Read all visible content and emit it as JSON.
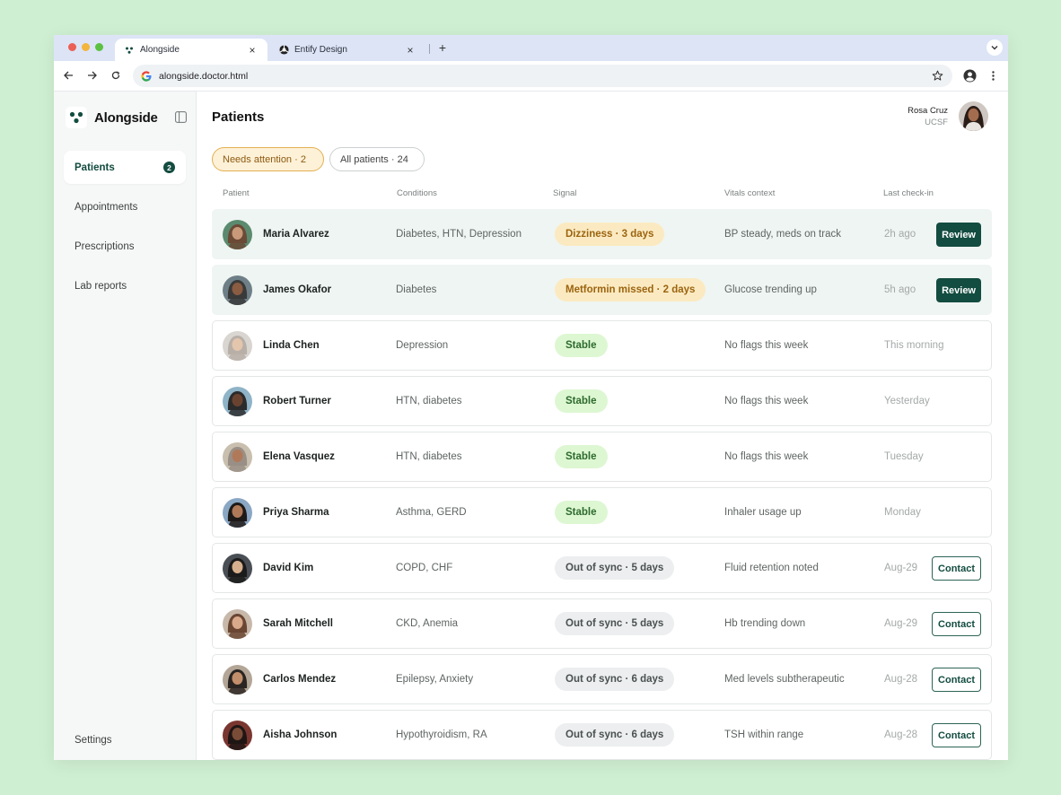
{
  "browser": {
    "tabs": [
      {
        "title": "Alongside",
        "active": true
      },
      {
        "title": "Entify Design",
        "active": false
      }
    ],
    "url": "alongside.doctor.html"
  },
  "sidebar": {
    "brand": "Alongside",
    "items": [
      {
        "label": "Patients",
        "badge": "2",
        "active": true
      },
      {
        "label": "Appointments"
      },
      {
        "label": "Prescriptions"
      },
      {
        "label": "Lab reports"
      }
    ],
    "settings": "Settings"
  },
  "header": {
    "title": "Patients",
    "user": {
      "name": "Rosa Cruz",
      "org": "UCSF"
    }
  },
  "filters": {
    "needs_attention": "Needs attention · 2",
    "all_patients": "All patients · 24"
  },
  "table": {
    "columns": [
      "Patient",
      "Conditions",
      "Signal",
      "Vitals context",
      "Last check-in"
    ],
    "rows": [
      {
        "name": "Maria Alvarez",
        "conditions": "Diabetes, HTN, Depression",
        "signal": "Dizziness · 3 days",
        "signal_type": "warn",
        "vitals": "BP steady, meds on track",
        "checkin": "2h ago",
        "action": "Review",
        "attention": true
      },
      {
        "name": "James Okafor",
        "conditions": "Diabetes",
        "signal": "Metformin missed · 2 days",
        "signal_type": "warn",
        "vitals": "Glucose trending up",
        "checkin": "5h ago",
        "action": "Review",
        "attention": true
      },
      {
        "name": "Linda Chen",
        "conditions": "Depression",
        "signal": "Stable",
        "signal_type": "stable",
        "vitals": "No flags this week",
        "checkin": "This morning",
        "action": ""
      },
      {
        "name": "Robert Turner",
        "conditions": "HTN, diabetes",
        "signal": "Stable",
        "signal_type": "stable",
        "vitals": "No flags this week",
        "checkin": "Yesterday",
        "action": ""
      },
      {
        "name": "Elena Vasquez",
        "conditions": "HTN, diabetes",
        "signal": "Stable",
        "signal_type": "stable",
        "vitals": "No flags this week",
        "checkin": "Tuesday",
        "action": ""
      },
      {
        "name": "Priya Sharma",
        "conditions": "Asthma, GERD",
        "signal": "Stable",
        "signal_type": "stable",
        "vitals": "Inhaler usage up",
        "checkin": "Monday",
        "action": ""
      },
      {
        "name": "David Kim",
        "conditions": "COPD, CHF",
        "signal": "Out of sync ·  5 days",
        "signal_type": "sync",
        "vitals": "Fluid retention noted",
        "checkin": "Aug-29",
        "action": "Contact"
      },
      {
        "name": "Sarah Mitchell",
        "conditions": "CKD, Anemia",
        "signal": "Out of sync ·  5 days",
        "signal_type": "sync",
        "vitals": "Hb trending down",
        "checkin": "Aug-29",
        "action": "Contact"
      },
      {
        "name": "Carlos Mendez",
        "conditions": "Epilepsy, Anxiety",
        "signal": "Out of sync ·  6 days",
        "signal_type": "sync",
        "vitals": "Med levels subtherapeutic",
        "checkin": "Aug-28",
        "action": "Contact"
      },
      {
        "name": "Aisha Johnson",
        "conditions": "Hypothyroidism, RA",
        "signal": "Out of sync ·  6 days",
        "signal_type": "sync",
        "vitals": "TSH within range",
        "checkin": "Aug-28",
        "action": "Contact"
      }
    ]
  },
  "colors": {
    "accent": "#134c40",
    "background": "#cfefd2",
    "warn": "#fbeac1",
    "stable": "#ddf7d2",
    "sync": "#eceeef"
  }
}
